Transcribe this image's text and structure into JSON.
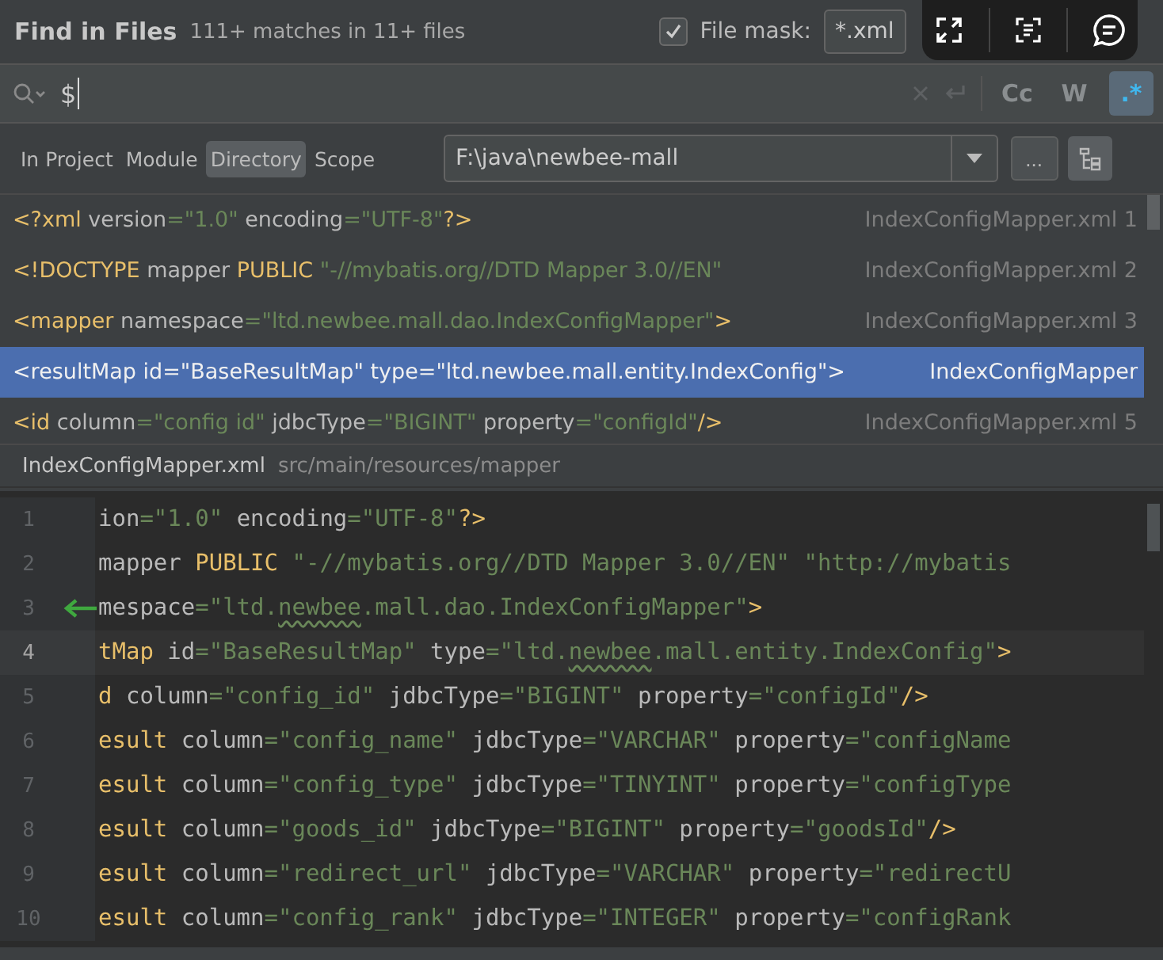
{
  "header": {
    "title": "Find in Files",
    "summary": "111+ matches in 11+ files",
    "file_mask": {
      "label": "File mask:",
      "checked": true,
      "value": "*.xml"
    }
  },
  "search": {
    "value": "$",
    "toggles": [
      {
        "label": "Cc",
        "selected": false
      },
      {
        "label": "W",
        "selected": false
      },
      {
        "label": ".*",
        "selected": true
      }
    ]
  },
  "scopes": [
    {
      "label": "In Project",
      "selected": false
    },
    {
      "label": "Module",
      "selected": false
    },
    {
      "label": "Directory",
      "selected": true
    },
    {
      "label": "Scope",
      "selected": false
    }
  ],
  "directory": {
    "value": "F:\\java\\newbee-mall",
    "browse_label": "..."
  },
  "results": [
    {
      "selected": false,
      "file": "IndexConfigMapper.xml 1",
      "tokens": [
        {
          "kind": "tag",
          "text": "<?xml"
        },
        {
          "kind": "attr",
          "text": " version"
        },
        {
          "kind": "str",
          "text": "=\"1.0\""
        },
        {
          "kind": "attr",
          "text": " encoding"
        },
        {
          "kind": "str",
          "text": "=\"UTF-8\""
        },
        {
          "kind": "tag",
          "text": "?>"
        }
      ]
    },
    {
      "selected": false,
      "file": "IndexConfigMapper.xml 2",
      "tokens": [
        {
          "kind": "tag",
          "text": "<!DOCTYPE"
        },
        {
          "kind": "attr",
          "text": " mapper"
        },
        {
          "kind": "tag",
          "text": " PUBLIC"
        },
        {
          "kind": "str",
          "text": " \"-//mybatis.org//DTD Mapper 3.0//EN\""
        }
      ]
    },
    {
      "selected": false,
      "file": "IndexConfigMapper.xml 3",
      "tokens": [
        {
          "kind": "tag",
          "text": "<mapper"
        },
        {
          "kind": "attr",
          "text": " namespace"
        },
        {
          "kind": "str",
          "text": "=\"ltd.newbee.mall.dao.IndexConfigMapper\""
        },
        {
          "kind": "tag",
          "text": ">"
        }
      ]
    },
    {
      "selected": true,
      "file": "IndexConfigMapper",
      "tokens": [
        {
          "kind": "tag",
          "text": "<resultMap"
        },
        {
          "kind": "attr",
          "text": " id"
        },
        {
          "kind": "str",
          "text": "=\"BaseResultMap\""
        },
        {
          "kind": "attr",
          "text": " type"
        },
        {
          "kind": "str",
          "text": "=\"ltd.newbee.mall.entity.IndexConfig\""
        },
        {
          "kind": "tag",
          "text": ">"
        }
      ]
    },
    {
      "selected": false,
      "file": "IndexConfigMapper.xml 5",
      "tokens": [
        {
          "kind": "tag",
          "text": "<id"
        },
        {
          "kind": "attr",
          "text": " column"
        },
        {
          "kind": "str",
          "text": "=\"config id\""
        },
        {
          "kind": "attr",
          "text": " jdbcType"
        },
        {
          "kind": "str",
          "text": "=\"BIGINT\""
        },
        {
          "kind": "attr",
          "text": " property"
        },
        {
          "kind": "str",
          "text": "=\"configId\""
        },
        {
          "kind": "tag",
          "text": "/>"
        }
      ]
    }
  ],
  "preview": {
    "file": "IndexConfigMapper.xml",
    "path": "src/main/resources/mapper"
  },
  "editor": {
    "lines": [
      {
        "number": "1",
        "current": false,
        "arrow": false,
        "tokens": [
          {
            "kind": "attr",
            "text": "ion"
          },
          {
            "kind": "str",
            "text": "=\"1.0\""
          },
          {
            "kind": "attr",
            "text": " encoding"
          },
          {
            "kind": "str",
            "text": "=\"UTF-8\""
          },
          {
            "kind": "tag",
            "text": "?>"
          }
        ]
      },
      {
        "number": "2",
        "current": false,
        "arrow": false,
        "tokens": [
          {
            "kind": "attr",
            "text": "mapper"
          },
          {
            "kind": "tag",
            "text": " PUBLIC"
          },
          {
            "kind": "str",
            "text": " \"-//mybatis.org//DTD Mapper 3.0//EN\" \"http://mybatis"
          }
        ]
      },
      {
        "number": "3",
        "current": false,
        "arrow": true,
        "tokens": [
          {
            "kind": "attr",
            "text": "mespace"
          },
          {
            "kind": "str",
            "text": "=\"ltd."
          },
          {
            "kind": "typo",
            "text": "newbee"
          },
          {
            "kind": "str",
            "text": ".mall.dao.IndexConfigMapper\""
          },
          {
            "kind": "tag",
            "text": ">"
          }
        ]
      },
      {
        "number": "4",
        "current": true,
        "arrow": false,
        "tokens": [
          {
            "kind": "tag",
            "text": "tMap"
          },
          {
            "kind": "attr",
            "text": " id"
          },
          {
            "kind": "str",
            "text": "=\"BaseResultMap\""
          },
          {
            "kind": "attr",
            "text": " type"
          },
          {
            "kind": "str",
            "text": "=\"ltd."
          },
          {
            "kind": "typo",
            "text": "newbee"
          },
          {
            "kind": "str",
            "text": ".mall.entity.IndexConfig\""
          },
          {
            "kind": "tag",
            "text": ">"
          }
        ]
      },
      {
        "number": "5",
        "current": false,
        "arrow": false,
        "tokens": [
          {
            "kind": "tag",
            "text": "d"
          },
          {
            "kind": "attr",
            "text": " column"
          },
          {
            "kind": "str",
            "text": "=\"config_id\""
          },
          {
            "kind": "attr",
            "text": " jdbcType"
          },
          {
            "kind": "str",
            "text": "=\"BIGINT\""
          },
          {
            "kind": "attr",
            "text": " property"
          },
          {
            "kind": "str",
            "text": "=\"configId\""
          },
          {
            "kind": "tag",
            "text": "/>"
          }
        ]
      },
      {
        "number": "6",
        "current": false,
        "arrow": false,
        "tokens": [
          {
            "kind": "tag",
            "text": "esult"
          },
          {
            "kind": "attr",
            "text": " column"
          },
          {
            "kind": "str",
            "text": "=\"config_name\""
          },
          {
            "kind": "attr",
            "text": " jdbcType"
          },
          {
            "kind": "str",
            "text": "=\"VARCHAR\""
          },
          {
            "kind": "attr",
            "text": " property"
          },
          {
            "kind": "str",
            "text": "=\"configName"
          }
        ]
      },
      {
        "number": "7",
        "current": false,
        "arrow": false,
        "tokens": [
          {
            "kind": "tag",
            "text": "esult"
          },
          {
            "kind": "attr",
            "text": " column"
          },
          {
            "kind": "str",
            "text": "=\"config_type\""
          },
          {
            "kind": "attr",
            "text": " jdbcType"
          },
          {
            "kind": "str",
            "text": "=\"TINYINT\""
          },
          {
            "kind": "attr",
            "text": " property"
          },
          {
            "kind": "str",
            "text": "=\"configType"
          }
        ]
      },
      {
        "number": "8",
        "current": false,
        "arrow": false,
        "tokens": [
          {
            "kind": "tag",
            "text": "esult"
          },
          {
            "kind": "attr",
            "text": " column"
          },
          {
            "kind": "str",
            "text": "=\"goods_id\""
          },
          {
            "kind": "attr",
            "text": " jdbcType"
          },
          {
            "kind": "str",
            "text": "=\"BIGINT\""
          },
          {
            "kind": "attr",
            "text": " property"
          },
          {
            "kind": "str",
            "text": "=\"goodsId\""
          },
          {
            "kind": "tag",
            "text": "/>"
          }
        ]
      },
      {
        "number": "9",
        "current": false,
        "arrow": false,
        "tokens": [
          {
            "kind": "tag",
            "text": "esult"
          },
          {
            "kind": "attr",
            "text": " column"
          },
          {
            "kind": "str",
            "text": "=\"redirect_url\""
          },
          {
            "kind": "attr",
            "text": " jdbcType"
          },
          {
            "kind": "str",
            "text": "=\"VARCHAR\""
          },
          {
            "kind": "attr",
            "text": " property"
          },
          {
            "kind": "str",
            "text": "=\"redirectU"
          }
        ]
      },
      {
        "number": "10",
        "current": false,
        "arrow": false,
        "tokens": [
          {
            "kind": "tag",
            "text": "esult"
          },
          {
            "kind": "attr",
            "text": " column"
          },
          {
            "kind": "str",
            "text": "=\"config_rank\""
          },
          {
            "kind": "attr",
            "text": " jdbcType"
          },
          {
            "kind": "str",
            "text": "=\"INTEGER\""
          },
          {
            "kind": "attr",
            "text": " property"
          },
          {
            "kind": "str",
            "text": "=\"configRank"
          }
        ]
      }
    ]
  }
}
